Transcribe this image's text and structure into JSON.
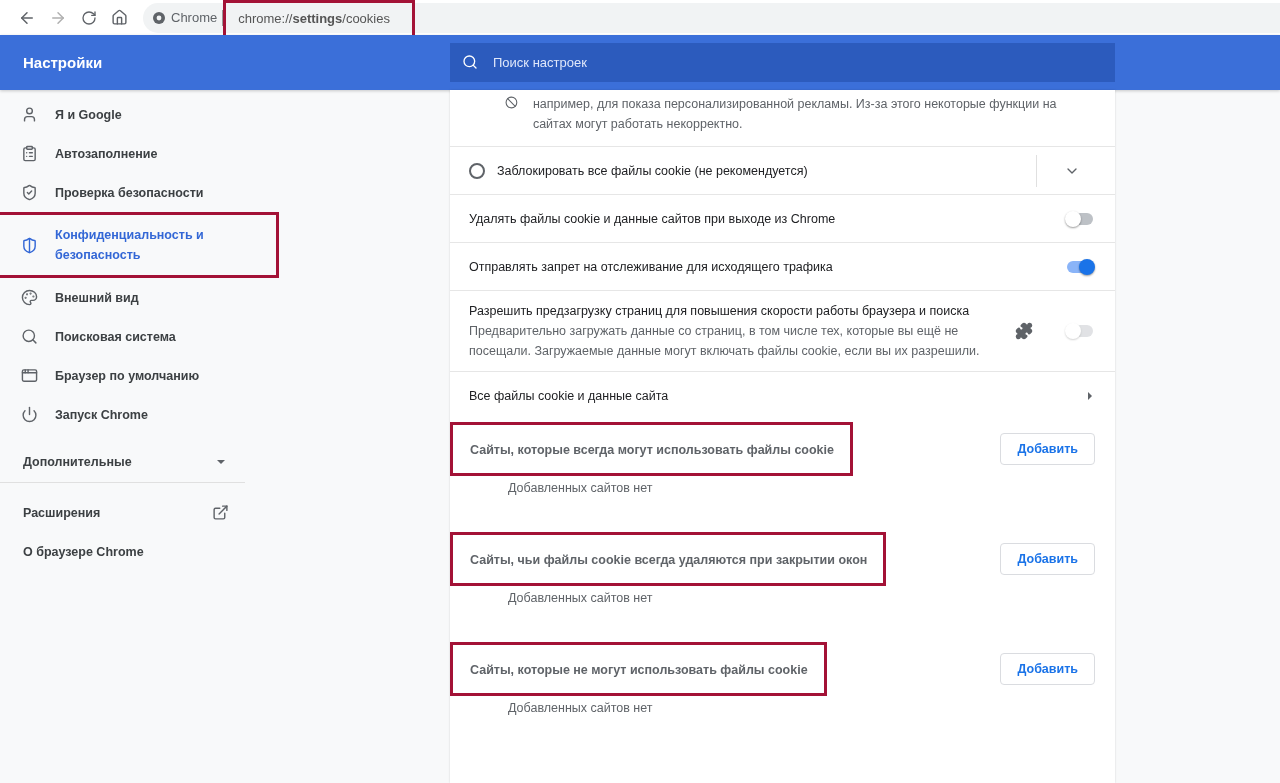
{
  "browser": {
    "origin_label": "Chrome",
    "url": "chrome://**settings**/cookies",
    "url_highlighted": true
  },
  "header": {
    "title": "Настройки",
    "search_placeholder": "Поиск настроек"
  },
  "sidebar": {
    "items": [
      {
        "label": "Я и Google",
        "selected": false,
        "highlighted": false
      },
      {
        "label": "Автозаполнение",
        "selected": false,
        "highlighted": false
      },
      {
        "label": "Проверка безопасности",
        "selected": false,
        "highlighted": false
      },
      {
        "label": "Конфиденциальность и безопасность",
        "selected": true,
        "highlighted": true
      },
      {
        "label": "Внешний вид",
        "selected": false,
        "highlighted": false
      },
      {
        "label": "Поисковая система",
        "selected": false,
        "highlighted": false
      },
      {
        "label": "Браузер по умолчанию",
        "selected": false,
        "highlighted": false
      },
      {
        "label": "Запуск Chrome",
        "selected": false,
        "highlighted": false
      }
    ],
    "advanced": {
      "label": "Дополнительные",
      "expanded": false
    },
    "links": [
      {
        "label": "Расширения",
        "external": true
      },
      {
        "label": "О браузере Chrome",
        "external": false
      }
    ]
  },
  "content": {
    "partial_option_text": "например, для показа персонализированной рекламы. Из-за этого некоторые функции на сайтах могут работать некорректно.",
    "block_option": {
      "label": "Заблокировать все файлы cookie (не рекомендуется)",
      "selected": false,
      "expanded": false
    },
    "toggles": [
      {
        "label": "Удалять файлы cookie и данные сайтов при выходе из Chrome",
        "on": false,
        "disabled": false,
        "extension_managed": false
      },
      {
        "label": "Отправлять запрет на отслеживание для исходящего трафика",
        "on": true,
        "disabled": false,
        "extension_managed": false
      },
      {
        "label": "Разрешить предзагрузку страниц для повышения скорости работы браузера и поиска",
        "description": "Предварительно загружать данные со страниц, в том числе тех, которые вы ещё не посещали. Загружаемые данные могут включать файлы cookie, если вы их разрешили.",
        "on": false,
        "disabled": true,
        "extension_managed": true
      }
    ],
    "all_cookies_link": "Все файлы cookie и данные сайта",
    "site_lists": [
      {
        "title": "Сайты, которые всегда могут использовать файлы cookie",
        "highlighted": true,
        "button": "Добавить",
        "empty_text": "Добавленных сайтов нет"
      },
      {
        "title": "Сайты, чьи файлы cookie всегда удаляются при закрытии окон",
        "highlighted": true,
        "button": "Добавить",
        "empty_text": "Добавленных сайтов нет"
      },
      {
        "title": "Сайты, которые не могут использовать файлы cookie",
        "highlighted": true,
        "button": "Добавить",
        "empty_text": "Добавленных сайтов нет"
      }
    ]
  }
}
